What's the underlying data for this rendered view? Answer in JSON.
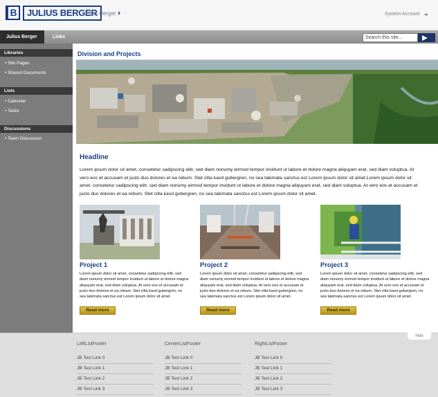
{
  "header": {
    "logo_letter": "B",
    "logo_text": "JULIUS BERGER",
    "site_title": "Julius Berger",
    "account_label": "System Account"
  },
  "nav": {
    "active_tab": "Julius Berger",
    "links_tab": "Links",
    "search_placeholder": "Search this site..."
  },
  "sidebar": {
    "sections": [
      {
        "title": "Libraries",
        "items": [
          "Site Pages",
          "Shared Documents"
        ]
      },
      {
        "title": "Lists",
        "items": [
          "Calendar",
          "Tasks"
        ]
      },
      {
        "title": "Discussions",
        "items": [
          "Team Discussion"
        ]
      }
    ]
  },
  "main": {
    "title": "Division and Projects",
    "headline": "Headline",
    "body": "Lorem ipsum dolor sit amet, consetetur sadipscing elitr, sed diam nonumy eirmod tempor invidunt ut labore et dolore magna aliquyam erat, sed diam voluptua. At vero eos et accusam et justo duo dolores et ea rebum. Stet clita kasd gubergren, no sea takimata sanctus est Lorem ipsum dolor sit amet.Lorem ipsum dolor sit amet, consetetur sadipscing elitr, sed diam nonumy eirmod tempor invidunt ut labore et dolore magna aliquyam erat, sed diam voluptua. At vero eos et accusam et justo duo dolores et ea rebum. Stet clita kasd gubergren, no sea takimata sanctus est Lorem ipsum dolor sit amet.",
    "projects": [
      {
        "title": "Project 1",
        "text": "Lorem ipsum dolor sit amet, consetetur sadipscing elitr, sed diam nonumy eirmod tempor invidunt ut labore et dolore magna aliquyam erat, sed diam voluptua. At vero eos et accusam et justo duo dolores et ea rebum. Stet clita kasd gubergren, no sea takimata sanctus est Lorem ipsum dolor sit amet.",
        "button": "Read more"
      },
      {
        "title": "Project 2",
        "text": "Lorem ipsum dolor sit amet, consetetur sadipscing elitr, sed diam nonumy eirmod tempor invidunt ut labore et dolore magna aliquyam erat, sed diam voluptua. At vero eos et accusam et justo duo dolores et ea rebum. Stet clita kasd gubergren, no sea takimata sanctus est Lorem ipsum dolor sit amet.",
        "button": "Read more"
      },
      {
        "title": "Project 3",
        "text": "Lorem ipsum dolor sit amet, consetetur sadipscing elitr, sed diam nonumy eirmod tempor invidunt ut labore et dolore magna aliquyam erat, sed diam voluptua. At vero eos et accusam et justo duo dolores et ea rebum. Stet clita kasd gubergren, no sea takimata sanctus est Lorem ipsum dolor sit amet.",
        "button": "Read more"
      }
    ]
  },
  "footer": {
    "hide_label": "hide",
    "columns": [
      {
        "title": "LeftListFooter",
        "links": [
          "JB Test Link 0",
          "JB Test Link 1",
          "JB Test Link 2",
          "JB Test Link 3"
        ]
      },
      {
        "title": "CenterListFooter",
        "links": [
          "JB Test Link 0",
          "JB Test Link 1",
          "JB Test Link 2",
          "JB Test Link 3"
        ]
      },
      {
        "title": "RightListFooter",
        "links": [
          "JB Test Link 0",
          "JB Test Link 1",
          "JB Test Link 2",
          "JB Test Link 3"
        ]
      }
    ]
  },
  "colors": {
    "brand_blue": "#1a3f86",
    "button_gold": "#d4b238",
    "nav_dark": "#2d2d2d",
    "sidebar_gray": "#7c7c7c",
    "footer_gray": "#dedede"
  }
}
